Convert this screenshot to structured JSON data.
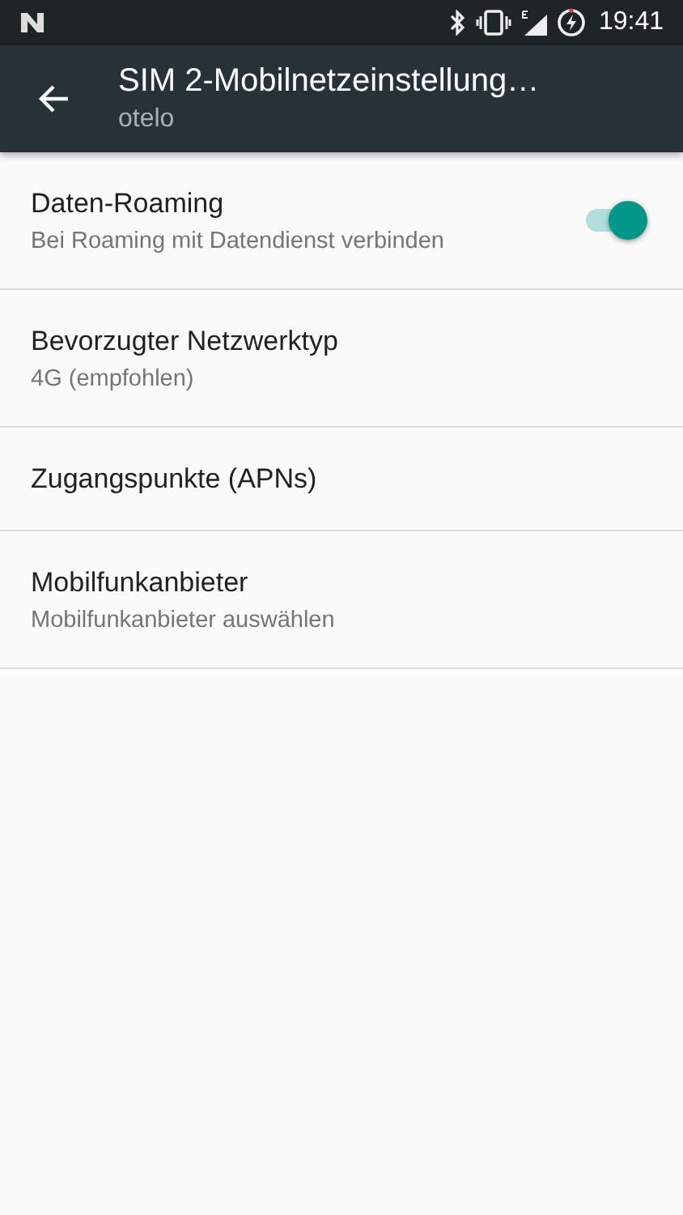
{
  "status_bar": {
    "time": "19:41"
  },
  "app_bar": {
    "title": "SIM 2-Mobilnetzeinstellung…",
    "subtitle": "otelo"
  },
  "settings": [
    {
      "kind": "switch",
      "title": "Daten-Roaming",
      "summary": "Bei Roaming mit Datendienst verbinden",
      "on": true
    },
    {
      "kind": "plain",
      "title": "Bevorzugter Netzwerktyp",
      "summary": "4G (empfohlen)"
    },
    {
      "kind": "plain",
      "title": "Zugangspunkte (APNs)"
    },
    {
      "kind": "plain",
      "title": "Mobilfunkanbieter",
      "summary": "Mobilfunkanbieter auswählen"
    }
  ]
}
